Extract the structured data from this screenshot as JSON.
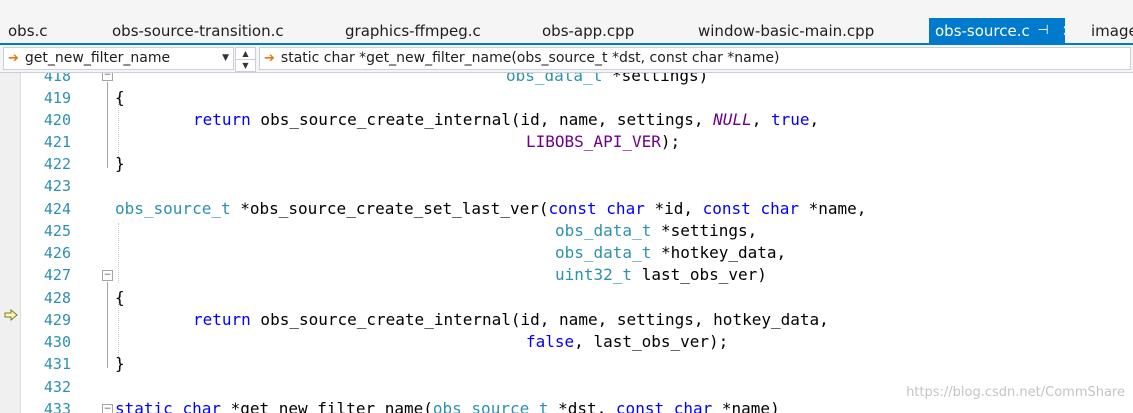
{
  "tabs": [
    {
      "label": "obs.c",
      "active": false
    },
    {
      "label": "obs-source-transition.c",
      "active": false
    },
    {
      "label": "graphics-ffmpeg.c",
      "active": false
    },
    {
      "label": "obs-app.cpp",
      "active": false
    },
    {
      "label": "window-basic-main.cpp",
      "active": false
    },
    {
      "label": "obs-source.c",
      "active": true
    },
    {
      "label": "image",
      "active": false
    }
  ],
  "active_tab_icons": {
    "pin": "pin-icon",
    "close": "close-icon"
  },
  "navbar": {
    "scope_combo": "get_new_filter_name",
    "member_combo": "static char *get_new_filter_name(obs_source_t *dst, const char *name)"
  },
  "lines": [
    {
      "number": "418",
      "text": "obs_data_t *settings)"
    },
    {
      "number": "419",
      "text": "{"
    },
    {
      "number": "420",
      "text": "return obs_source_create_internal(id, name, settings, NULL, true,"
    },
    {
      "number": "421",
      "text": "LIBOBS_API_VER);"
    },
    {
      "number": "422",
      "text": "}"
    },
    {
      "number": "423",
      "text": ""
    },
    {
      "number": "424",
      "text": "obs_source_t *obs_source_create_set_last_ver(const char *id, const char *name,"
    },
    {
      "number": "425",
      "text": "obs_data_t *settings,"
    },
    {
      "number": "426",
      "text": "obs_data_t *hotkey_data,"
    },
    {
      "number": "427",
      "text": "uint32_t last_obs_ver)"
    },
    {
      "number": "428",
      "text": "{"
    },
    {
      "number": "429",
      "text": "return obs_source_create_internal(id, name, settings, hotkey_data,"
    },
    {
      "number": "430",
      "text": "false, last_obs_ver);"
    },
    {
      "number": "431",
      "text": "}"
    },
    {
      "number": "432",
      "text": ""
    },
    {
      "number": "433",
      "text": "static char *get_new_filter_name(obs_source_t *dst, const char *name)"
    }
  ],
  "watermark": "https://blog.csdn.net/CommShare",
  "colors": {
    "accent": "#007acc",
    "keyword": "#0000ff",
    "type": "#2b91af",
    "macro": "#6f008a",
    "line_number": "#2b91af"
  }
}
